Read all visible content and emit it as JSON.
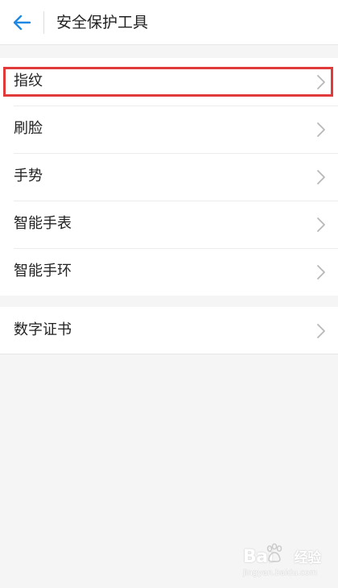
{
  "header": {
    "title": "安全保护工具",
    "back_icon": "back-arrow-icon",
    "accent_color": "#1e88e5"
  },
  "groups": [
    {
      "items": [
        {
          "label": "指纹",
          "highlighted": true
        },
        {
          "label": "刷脸"
        },
        {
          "label": "手势"
        },
        {
          "label": "智能手表"
        },
        {
          "label": "智能手环"
        }
      ]
    },
    {
      "items": [
        {
          "label": "数字证书"
        }
      ]
    }
  ],
  "chevron_icon": "chevron-right-icon",
  "highlight_color": "#e03a3a",
  "watermark": {
    "brand": "Bai",
    "suffix": "经验",
    "url": "jingyan.baidu.com"
  }
}
